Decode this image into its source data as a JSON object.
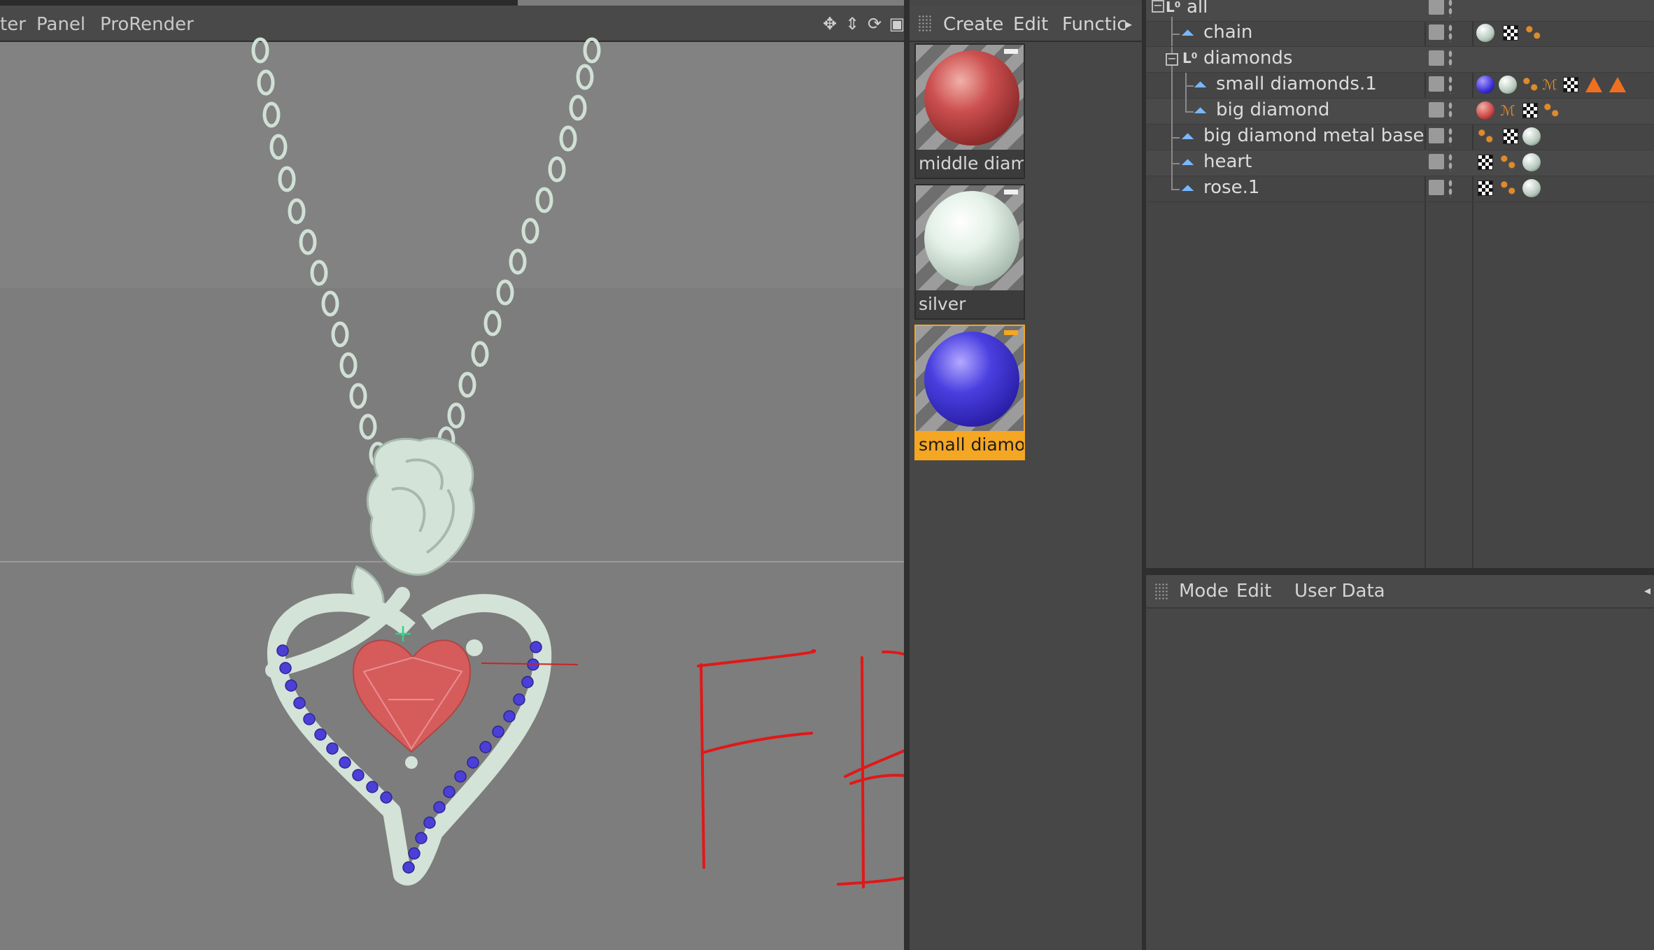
{
  "viewport": {
    "menu": [
      "ter",
      "Panel",
      "ProRender"
    ],
    "nav_icons": [
      "move-view-icon",
      "zoom-view-icon",
      "rotate-view-icon",
      "maximize-view-icon"
    ],
    "colors": {
      "background": "#7d7d7d",
      "model_metal": "#d3e3d8",
      "heart_gem": "#d65c5c",
      "small_gems": "#4b3fd8"
    }
  },
  "material_manager": {
    "menu": [
      "Create",
      "Edit",
      "Functic"
    ],
    "materials": [
      {
        "label": "middle diam",
        "color": "#c94545",
        "selected": false
      },
      {
        "label": "silver",
        "color": "#dfeee4",
        "selected": false
      },
      {
        "label": "small diamor",
        "color": "#3a2fd6",
        "selected": true
      }
    ],
    "selection_color": "#f5a623"
  },
  "object_manager": {
    "objects": [
      {
        "name": "all",
        "type": "null",
        "tags": []
      },
      {
        "name": "chain",
        "type": "polygon",
        "tags": [
          "silver-material",
          "checker-tag",
          "phong-tag"
        ]
      },
      {
        "name": "diamonds",
        "type": "null",
        "tags": []
      },
      {
        "name": "small diamonds.1",
        "type": "polygon",
        "tags": [
          "blue-material",
          "silver-material",
          "phong-tag",
          "wave-tag",
          "checker-tag",
          "warning-tag",
          "warning-tag"
        ]
      },
      {
        "name": "big diamond",
        "type": "polygon",
        "tags": [
          "red-material",
          "wave-tag",
          "checker-tag",
          "phong-tag"
        ]
      },
      {
        "name": "big diamond metal base",
        "type": "polygon",
        "tags": [
          "phong-tag",
          "checker-tag",
          "silver-material"
        ]
      },
      {
        "name": "heart",
        "type": "polygon",
        "tags": [
          "checker-tag",
          "phong-tag",
          "silver-material"
        ]
      },
      {
        "name": "rose.1",
        "type": "polygon",
        "tags": [
          "checker-tag",
          "phong-tag",
          "silver-material"
        ]
      }
    ]
  },
  "attribute_manager": {
    "menu": [
      "Mode",
      "Edit",
      "User Data"
    ]
  },
  "annotation": {
    "text": "FBX",
    "color": "#e01818"
  }
}
